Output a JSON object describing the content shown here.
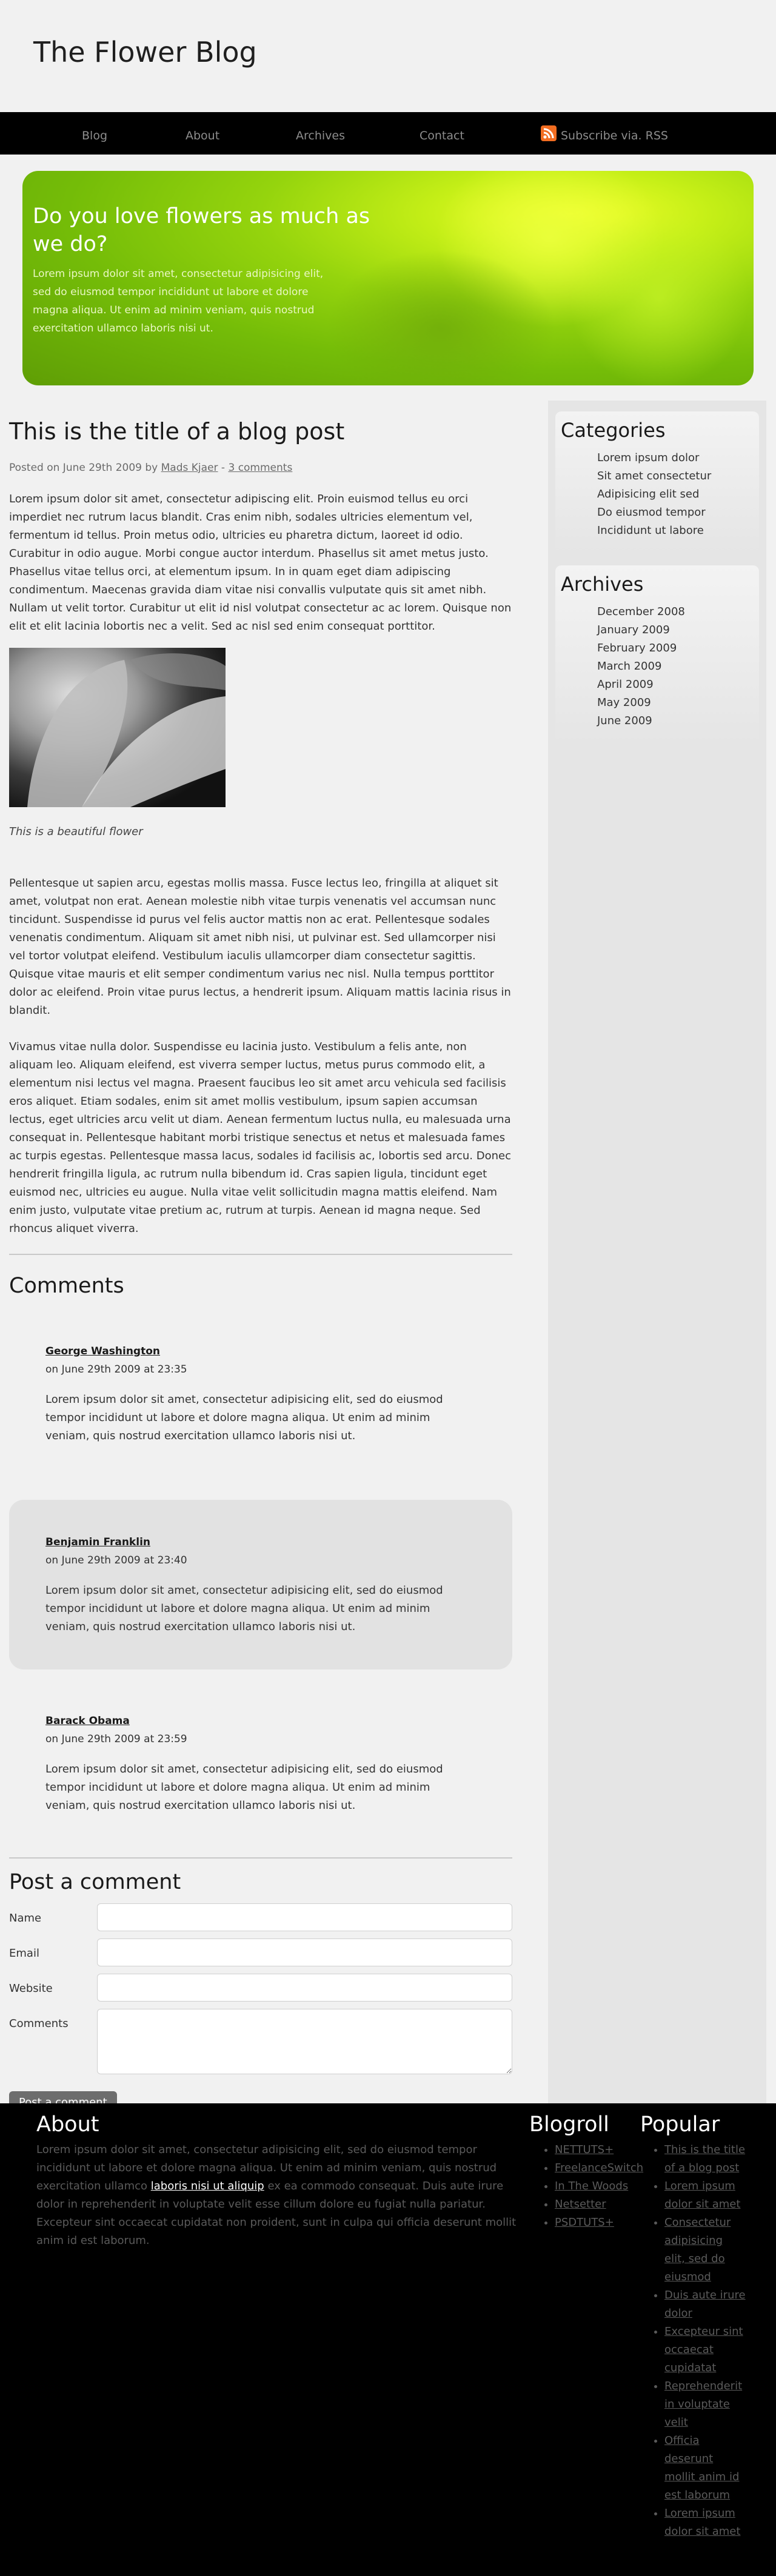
{
  "site": {
    "title": "The Flower Blog"
  },
  "nav": {
    "items": [
      "Blog",
      "About",
      "Archives",
      "Contact"
    ],
    "rss_label": "Subscribe via. RSS"
  },
  "hero": {
    "title": "Do you love flowers as much as we do?",
    "text": "Lorem ipsum dolor sit amet, consectetur adipisicing elit, sed do eiusmod tempor incididunt ut labore et dolore magna aliqua. Ut enim ad minim veniam, quis nostrud exercitation ullamco laboris nisi ut."
  },
  "post": {
    "title": "This is the title of a blog post",
    "meta_prefix": "Posted on June 29th 2009 by",
    "author": "Mads Kjaer",
    "meta_sep": "-",
    "comments_link": "3 comments",
    "para1": "Lorem ipsum dolor sit amet, consectetur adipiscing elit. Proin euismod tellus eu orci imperdiet nec rutrum lacus blandit. Cras enim nibh, sodales ultricies elementum vel, fermentum id tellus. Proin metus odio, ultricies eu pharetra dictum, laoreet id odio. Curabitur in odio augue. Morbi congue auctor interdum. Phasellus sit amet metus justo. Phasellus vitae tellus orci, at elementum ipsum. In in quam eget diam adipiscing condimentum. Maecenas gravida diam vitae nisi convallis vulputate quis sit amet nibh. Nullam ut velit tortor. Curabitur ut elit id nisl volutpat consectetur ac ac lorem. Quisque non elit et elit lacinia lobortis nec a velit. Sed ac nisl sed enim consequat porttitor.",
    "caption": "This is a beautiful flower",
    "para2": "Pellentesque ut sapien arcu, egestas mollis massa. Fusce lectus leo, fringilla at aliquet sit amet, volutpat non erat. Aenean molestie nibh vitae turpis venenatis vel accumsan nunc tincidunt. Suspendisse id purus vel felis auctor mattis non ac erat. Pellentesque sodales venenatis condimentum. Aliquam sit amet nibh nisi, ut pulvinar est. Sed ullamcorper nisi vel tortor volutpat eleifend. Vestibulum iaculis ullamcorper diam consectetur sagittis. Quisque vitae mauris et elit semper condimentum varius nec nisl. Nulla tempus porttitor dolor ac eleifend. Proin vitae purus lectus, a hendrerit ipsum. Aliquam mattis lacinia risus in blandit.",
    "para3": "Vivamus vitae nulla dolor. Suspendisse eu lacinia justo. Vestibulum a felis ante, non aliquam leo. Aliquam eleifend, est viverra semper luctus, metus purus commodo elit, a elementum nisi lectus vel magna. Praesent faucibus leo sit amet arcu vehicula sed facilisis eros aliquet. Etiam sodales, enim sit amet mollis vestibulum, ipsum sapien accumsan lectus, eget ultricies arcu velit ut diam. Aenean fermentum luctus nulla, eu malesuada urna consequat in. Pellentesque habitant morbi tristique senectus et netus et malesuada fames ac turpis egestas. Pellentesque massa lacus, sodales id facilisis ac, lobortis sed arcu. Donec hendrerit fringilla ligula, ac rutrum nulla bibendum id. Cras sapien ligula, tincidunt eget euismod nec, ultricies eu augue. Nulla vitae velit sollicitudin magna mattis eleifend. Nam enim justo, vulputate vitae pretium ac, rutrum at turpis. Aenean id magna neque. Sed rhoncus aliquet viverra."
  },
  "comments": {
    "heading": "Comments",
    "items": [
      {
        "author": "George Washington",
        "date": "on June 29th 2009 at 23:35",
        "text": "Lorem ipsum dolor sit amet, consectetur adipisicing elit, sed do eiusmod tempor incididunt ut labore et dolore magna aliqua. Ut enim ad minim veniam, quis nostrud exercitation ullamco laboris nisi ut."
      },
      {
        "author": "Benjamin Franklin",
        "date": "on June 29th 2009 at 23:40",
        "text": "Lorem ipsum dolor sit amet, consectetur adipisicing elit, sed do eiusmod tempor incididunt ut labore et dolore magna aliqua. Ut enim ad minim veniam, quis nostrud exercitation ullamco laboris nisi ut."
      },
      {
        "author": "Barack Obama",
        "date": "on June 29th 2009 at 23:59",
        "text": "Lorem ipsum dolor sit amet, consectetur adipisicing elit, sed do eiusmod tempor incididunt ut labore et dolore magna aliqua. Ut enim ad minim veniam, quis nostrud exercitation ullamco laboris nisi ut."
      }
    ]
  },
  "form": {
    "heading": "Post a comment",
    "name_label": "Name",
    "email_label": "Email",
    "website_label": "Website",
    "comments_label": "Comments",
    "submit_label": "Post a comment"
  },
  "sidebar": {
    "categories": {
      "title": "Categories",
      "items": [
        "Lorem ipsum dolor",
        "Sit amet consectetur",
        "Adipisicing elit sed",
        "Do eiusmod tempor",
        "Incididunt ut labore"
      ]
    },
    "archives": {
      "title": "Archives",
      "items": [
        "December 2008",
        "January 2009",
        "February 2009",
        "March 2009",
        "April 2009",
        "May 2009",
        "June 2009"
      ]
    }
  },
  "footer": {
    "about_title": "About",
    "about_text_before": "Lorem ipsum dolor sit amet, consectetur adipisicing elit, sed do eiusmod tempor incididunt ut labore et dolore magna aliqua. Ut enim ad minim veniam, quis nostrud exercitation ullamco",
    "about_link": "laboris nisi ut aliquip",
    "about_text_after": "ex ea commodo consequat. Duis aute irure dolor in reprehenderit in voluptate velit esse cillum dolore eu fugiat nulla pariatur. Excepteur sint occaecat cupidatat non proident, sunt in culpa qui officia deserunt mollit anim id est laborum.",
    "blogroll_title": "Blogroll",
    "blogroll": [
      "NETTUTS+",
      "FreelanceSwitch",
      "In The Woods",
      "Netsetter",
      "PSDTUTS+"
    ],
    "popular_title": "Popular",
    "popular": [
      "This is the title of a blog post",
      "Lorem ipsum dolor sit amet",
      "Consectetur adipisicing elit, sed do eiusmod",
      "Duis aute irure dolor",
      "Excepteur sint occaecat cupidatat",
      "Reprehenderit in voluptate velit",
      "Officia deserunt mollit anim id est laborum",
      "Lorem ipsum dolor sit amet"
    ]
  },
  "colors": {
    "nav_bg": "#000000",
    "page_bg": "#f1f1f1",
    "hero_green": "#8fd10c",
    "footer_bg": "#000000",
    "rss": "#f26d21"
  }
}
